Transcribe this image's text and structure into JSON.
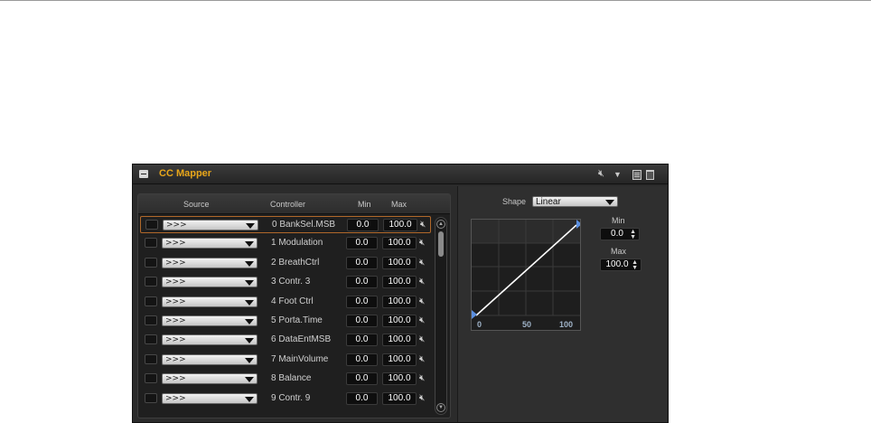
{
  "panel": {
    "title": "CC Mapper",
    "accent_color": "#e8a61a"
  },
  "toolbar_icons": [
    "speaker-mute-icon",
    "dropdown-arrow-icon",
    "save-icon",
    "trash-icon"
  ],
  "table": {
    "headers": {
      "source": "Source",
      "controller": "Controller",
      "min": "Min",
      "max": "Max"
    },
    "selected_row": 0,
    "rows": [
      {
        "source": ">>>",
        "controller": "0 BankSel.MSB",
        "min": "0.0",
        "max": "100.0"
      },
      {
        "source": ">>>",
        "controller": "1 Modulation",
        "min": "0.0",
        "max": "100.0"
      },
      {
        "source": ">>>",
        "controller": "2 BreathCtrl",
        "min": "0.0",
        "max": "100.0"
      },
      {
        "source": ">>>",
        "controller": "3 Contr. 3",
        "min": "0.0",
        "max": "100.0"
      },
      {
        "source": ">>>",
        "controller": "4 Foot Ctrl",
        "min": "0.0",
        "max": "100.0"
      },
      {
        "source": ">>>",
        "controller": "5 Porta.Time",
        "min": "0.0",
        "max": "100.0"
      },
      {
        "source": ">>>",
        "controller": "6 DataEntMSB",
        "min": "0.0",
        "max": "100.0"
      },
      {
        "source": ">>>",
        "controller": "7 MainVolume",
        "min": "0.0",
        "max": "100.0"
      },
      {
        "source": ">>>",
        "controller": "8 Balance",
        "min": "0.0",
        "max": "100.0"
      },
      {
        "source": ">>>",
        "controller": "9 Contr. 9",
        "min": "0.0",
        "max": "100.0"
      }
    ]
  },
  "curve": {
    "shape_label": "Shape",
    "shape_value": "Linear",
    "ticks": [
      "0",
      "50",
      "100"
    ],
    "min_label": "Min",
    "min_value": "0.0",
    "max_label": "Max",
    "max_value": "100.0",
    "line_color": "#ffffff",
    "handle_color": "#5b8fe0"
  }
}
